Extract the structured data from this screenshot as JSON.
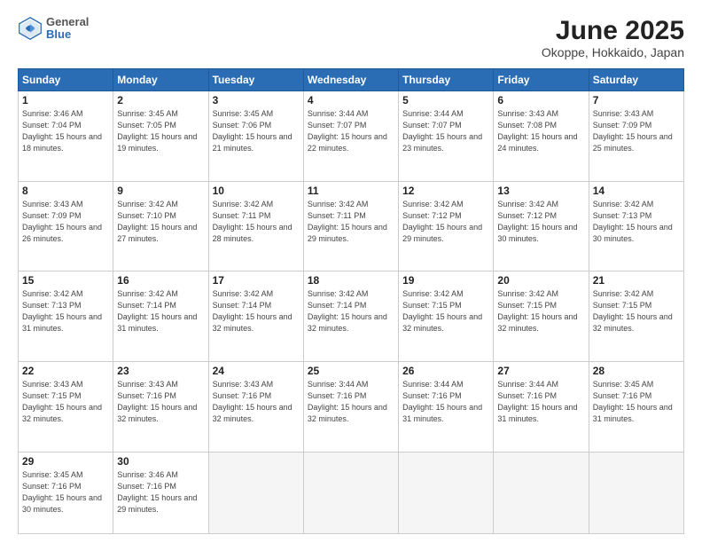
{
  "header": {
    "logo": {
      "general": "General",
      "blue": "Blue"
    },
    "title": "June 2025",
    "subtitle": "Okoppe, Hokkaido, Japan"
  },
  "calendar": {
    "weekdays": [
      "Sunday",
      "Monday",
      "Tuesday",
      "Wednesday",
      "Thursday",
      "Friday",
      "Saturday"
    ],
    "weeks": [
      [
        null,
        {
          "day": 2,
          "info": "Sunrise: 3:45 AM\nSunset: 7:05 PM\nDaylight: 15 hours\nand 19 minutes."
        },
        {
          "day": 3,
          "info": "Sunrise: 3:45 AM\nSunset: 7:06 PM\nDaylight: 15 hours\nand 21 minutes."
        },
        {
          "day": 4,
          "info": "Sunrise: 3:44 AM\nSunset: 7:07 PM\nDaylight: 15 hours\nand 22 minutes."
        },
        {
          "day": 5,
          "info": "Sunrise: 3:44 AM\nSunset: 7:07 PM\nDaylight: 15 hours\nand 23 minutes."
        },
        {
          "day": 6,
          "info": "Sunrise: 3:43 AM\nSunset: 7:08 PM\nDaylight: 15 hours\nand 24 minutes."
        },
        {
          "day": 7,
          "info": "Sunrise: 3:43 AM\nSunset: 7:09 PM\nDaylight: 15 hours\nand 25 minutes."
        }
      ],
      [
        {
          "day": 1,
          "info": "Sunrise: 3:46 AM\nSunset: 7:04 PM\nDaylight: 15 hours\nand 18 minutes.",
          "first": true
        },
        {
          "day": 8,
          "info": "Sunrise: 3:43 AM\nSunset: 7:09 PM\nDaylight: 15 hours\nand 26 minutes."
        },
        {
          "day": 9,
          "info": "Sunrise: 3:42 AM\nSunset: 7:10 PM\nDaylight: 15 hours\nand 27 minutes."
        },
        {
          "day": 10,
          "info": "Sunrise: 3:42 AM\nSunset: 7:11 PM\nDaylight: 15 hours\nand 28 minutes."
        },
        {
          "day": 11,
          "info": "Sunrise: 3:42 AM\nSunset: 7:11 PM\nDaylight: 15 hours\nand 29 minutes."
        },
        {
          "day": 12,
          "info": "Sunrise: 3:42 AM\nSunset: 7:12 PM\nDaylight: 15 hours\nand 29 minutes."
        },
        {
          "day": 13,
          "info": "Sunrise: 3:42 AM\nSunset: 7:12 PM\nDaylight: 15 hours\nand 30 minutes."
        },
        {
          "day": 14,
          "info": "Sunrise: 3:42 AM\nSunset: 7:13 PM\nDaylight: 15 hours\nand 30 minutes."
        }
      ],
      [
        {
          "day": 15,
          "info": "Sunrise: 3:42 AM\nSunset: 7:13 PM\nDaylight: 15 hours\nand 31 minutes."
        },
        {
          "day": 16,
          "info": "Sunrise: 3:42 AM\nSunset: 7:14 PM\nDaylight: 15 hours\nand 31 minutes."
        },
        {
          "day": 17,
          "info": "Sunrise: 3:42 AM\nSunset: 7:14 PM\nDaylight: 15 hours\nand 32 minutes."
        },
        {
          "day": 18,
          "info": "Sunrise: 3:42 AM\nSunset: 7:14 PM\nDaylight: 15 hours\nand 32 minutes."
        },
        {
          "day": 19,
          "info": "Sunrise: 3:42 AM\nSunset: 7:15 PM\nDaylight: 15 hours\nand 32 minutes."
        },
        {
          "day": 20,
          "info": "Sunrise: 3:42 AM\nSunset: 7:15 PM\nDaylight: 15 hours\nand 32 minutes."
        },
        {
          "day": 21,
          "info": "Sunrise: 3:42 AM\nSunset: 7:15 PM\nDaylight: 15 hours\nand 32 minutes."
        }
      ],
      [
        {
          "day": 22,
          "info": "Sunrise: 3:43 AM\nSunset: 7:15 PM\nDaylight: 15 hours\nand 32 minutes."
        },
        {
          "day": 23,
          "info": "Sunrise: 3:43 AM\nSunset: 7:16 PM\nDaylight: 15 hours\nand 32 minutes."
        },
        {
          "day": 24,
          "info": "Sunrise: 3:43 AM\nSunset: 7:16 PM\nDaylight: 15 hours\nand 32 minutes."
        },
        {
          "day": 25,
          "info": "Sunrise: 3:44 AM\nSunset: 7:16 PM\nDaylight: 15 hours\nand 32 minutes."
        },
        {
          "day": 26,
          "info": "Sunrise: 3:44 AM\nSunset: 7:16 PM\nDaylight: 15 hours\nand 31 minutes."
        },
        {
          "day": 27,
          "info": "Sunrise: 3:44 AM\nSunset: 7:16 PM\nDaylight: 15 hours\nand 31 minutes."
        },
        {
          "day": 28,
          "info": "Sunrise: 3:45 AM\nSunset: 7:16 PM\nDaylight: 15 hours\nand 31 minutes."
        }
      ],
      [
        {
          "day": 29,
          "info": "Sunrise: 3:45 AM\nSunset: 7:16 PM\nDaylight: 15 hours\nand 30 minutes."
        },
        {
          "day": 30,
          "info": "Sunrise: 3:46 AM\nSunset: 7:16 PM\nDaylight: 15 hours\nand 29 minutes."
        },
        null,
        null,
        null,
        null,
        null
      ]
    ]
  }
}
